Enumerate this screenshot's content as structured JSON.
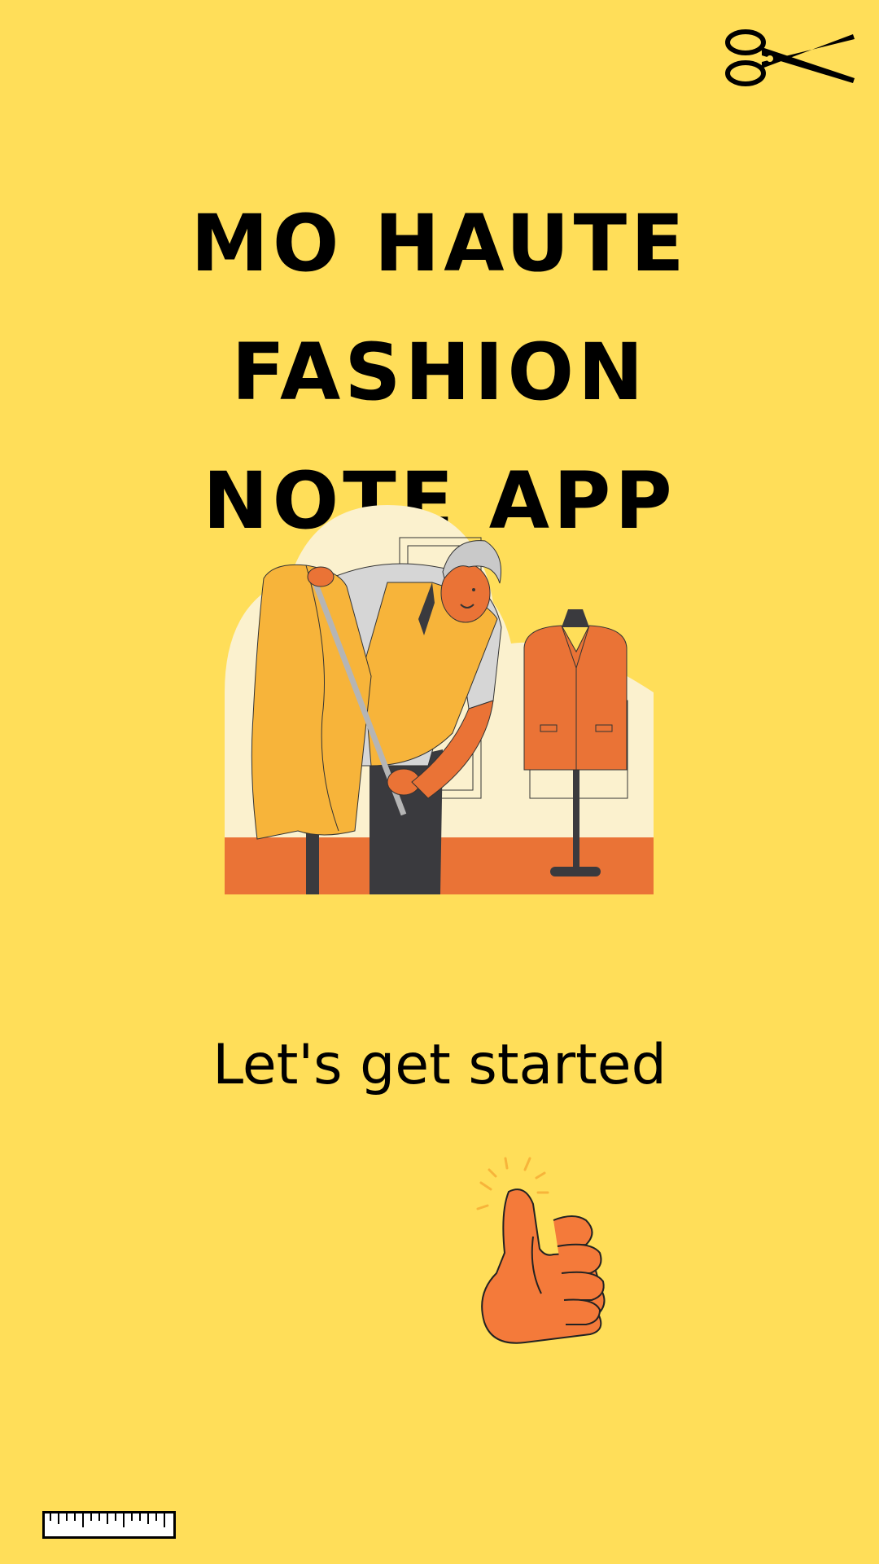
{
  "title": {
    "line1": "MO HAUTE FASHION",
    "line2": "NOTE APP"
  },
  "cta": {
    "label": "Let's get started"
  },
  "icons": {
    "top_right": "scissors-icon",
    "hero": "tailor-illustration",
    "bottom": "thumbs-up-icon",
    "bottom_left": "ruler-icon"
  },
  "colors": {
    "background": "#ffde59",
    "orange": "#f47a3a",
    "accent_yellow": "#f7b43a",
    "dark": "#3a3a3e"
  }
}
